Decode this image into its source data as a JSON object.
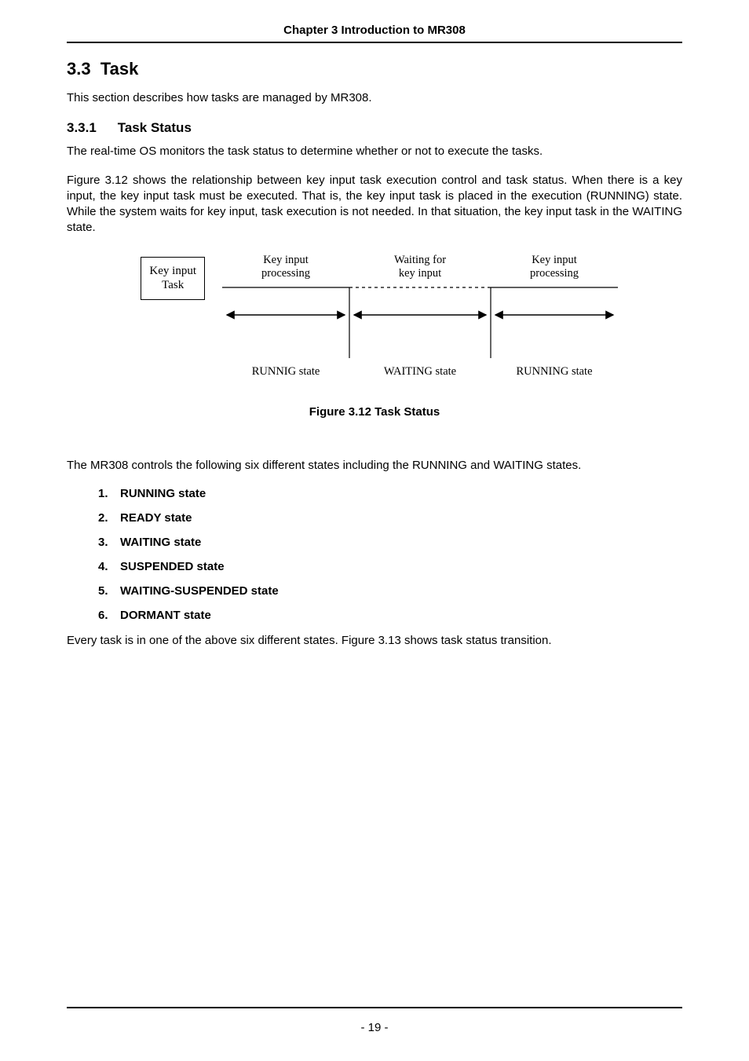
{
  "chapter_header": "Chapter 3 Introduction to MR308",
  "section": {
    "number": "3.3",
    "title": "Task",
    "intro": "This section describes how tasks are managed by MR308."
  },
  "subsection": {
    "number": "3.3.1",
    "title": "Task Status",
    "p1": "The real-time OS monitors the task status to determine whether or not to execute the tasks.",
    "p2": "Figure 3.12 shows the relationship between key input task execution control and task status. When there is a key input, the key input task must be executed. That is, the key input task is placed in the execution (RUNNING) state. While the system waits for key input, task execution is not needed. In that situation, the key input task in the WAITING state."
  },
  "figure": {
    "box_line1": "Key input",
    "box_line2": "Task",
    "top1_line1": "Key input",
    "top1_line2": "processing",
    "top2_line1": "Waiting for",
    "top2_line2": "key input",
    "top3_line1": "Key input",
    "top3_line2": "processing",
    "state1": "RUNNIG state",
    "state2": "WAITING state",
    "state3": "RUNNING state",
    "caption": "Figure 3.12 Task Status"
  },
  "after_figure": "The MR308 controls the following six different states including the RUNNING and WAITING states.",
  "states": [
    {
      "n": "1.",
      "t": "RUNNING state"
    },
    {
      "n": "2.",
      "t": "READY state"
    },
    {
      "n": "3.",
      "t": "WAITING state"
    },
    {
      "n": "4.",
      "t": "SUSPENDED state"
    },
    {
      "n": "5.",
      "t": "WAITING-SUSPENDED state"
    },
    {
      "n": "6.",
      "t": "DORMANT state"
    }
  ],
  "closing": "Every task is in one of the above six different states. Figure 3.13 shows task status transition.",
  "page_number": "- 19 -"
}
